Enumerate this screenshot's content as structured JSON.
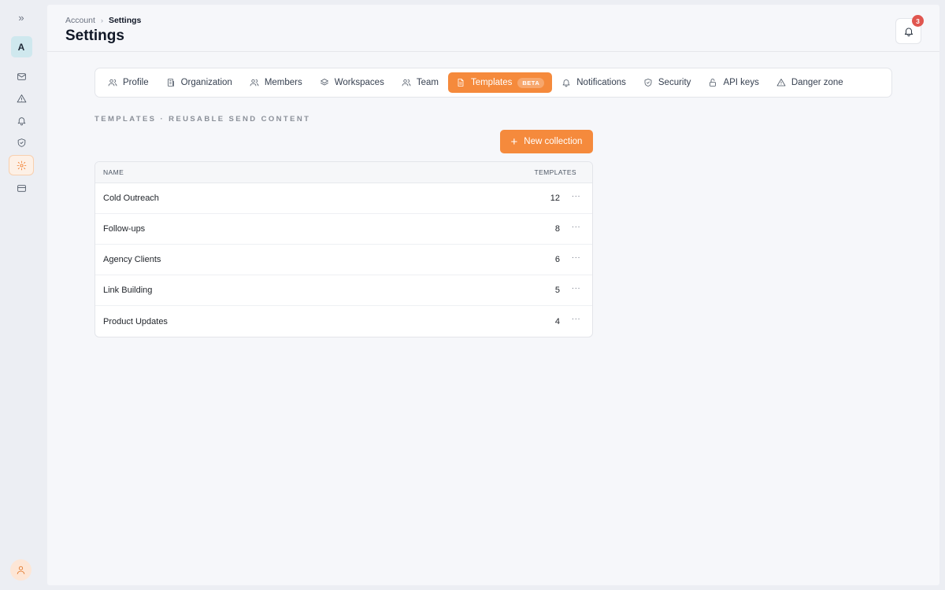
{
  "sidebar": {
    "toggle_glyph": "»",
    "avatar_letter": "A",
    "items": [
      {
        "name": "mail-icon",
        "active": false
      },
      {
        "name": "alert-triangle-icon",
        "active": false
      },
      {
        "name": "bell-icon",
        "active": false
      },
      {
        "name": "shield-icon",
        "active": false
      },
      {
        "name": "gear-icon",
        "active": true
      },
      {
        "name": "credit-card-icon",
        "active": false
      }
    ],
    "user_icon": "user-icon"
  },
  "header": {
    "breadcrumb": [
      "Account",
      "Settings"
    ],
    "title": "Settings",
    "notifications_count": "3"
  },
  "tabs": [
    {
      "label": "Profile",
      "icon": "users-icon"
    },
    {
      "label": "Organization",
      "icon": "building-icon"
    },
    {
      "label": "Members",
      "icon": "users-icon"
    },
    {
      "label": "Workspaces",
      "icon": "layers-icon"
    },
    {
      "label": "Team",
      "icon": "users-icon"
    },
    {
      "label": "Templates",
      "icon": "document-icon",
      "active": true,
      "badge": "BETA"
    },
    {
      "label": "Notifications",
      "icon": "bell-icon"
    },
    {
      "label": "Security",
      "icon": "shield-icon"
    },
    {
      "label": "API keys",
      "icon": "lock-icon"
    },
    {
      "label": "Danger zone",
      "icon": "alert-triangle-icon"
    }
  ],
  "section": {
    "label": "TEMPLATES · REUSABLE SEND CONTENT",
    "new_button_label": "New collection"
  },
  "table": {
    "columns": [
      "NAME",
      "TEMPLATES"
    ],
    "rows": [
      {
        "name": "Cold Outreach",
        "count": "12"
      },
      {
        "name": "Follow-ups",
        "count": "8"
      },
      {
        "name": "Agency Clients",
        "count": "6"
      },
      {
        "name": "Link Building",
        "count": "5"
      },
      {
        "name": "Product Updates",
        "count": "4"
      }
    ],
    "more_glyph": "···"
  },
  "colors": {
    "accent": "#f58a3c",
    "badge": "#e0564f"
  }
}
